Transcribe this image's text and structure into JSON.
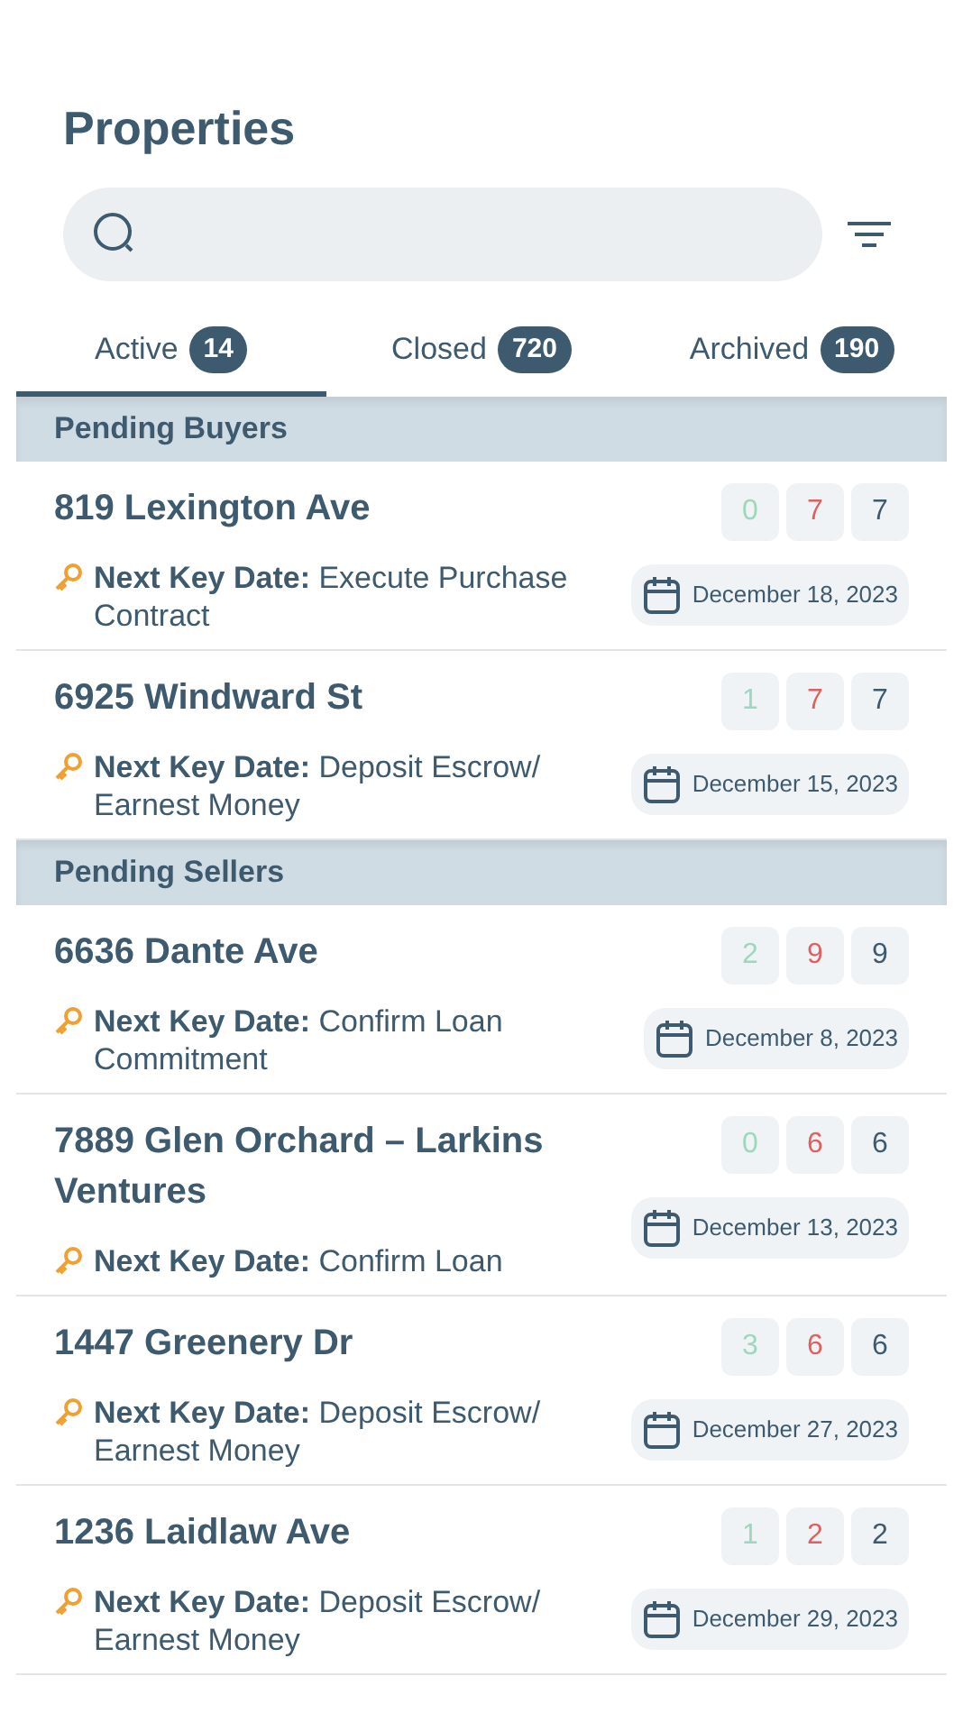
{
  "title": "Properties",
  "tabs": [
    {
      "label": "Active",
      "count": "14",
      "selected": true
    },
    {
      "label": "Closed",
      "count": "720",
      "selected": false
    },
    {
      "label": "Archived",
      "count": "190",
      "selected": false
    }
  ],
  "sections": [
    {
      "heading": "Pending Buyers",
      "items": [
        {
          "address": "819 Lexington Ave",
          "counts": {
            "done": "0",
            "overdue": "7",
            "total": "7"
          },
          "next_key": "**Next Key Date:** Execute Purchase Contract",
          "date": "December 18, 2023"
        },
        {
          "address": "6925 Windward St",
          "counts": {
            "done": "1",
            "overdue": "7",
            "total": "7"
          },
          "next_key": "**Next Key Date:** Deposit Escrow/ Earnest Money",
          "date": "December 15, 2023"
        }
      ]
    },
    {
      "heading": "Pending Sellers",
      "items": [
        {
          "address": "6636 Dante Ave",
          "counts": {
            "done": "2",
            "overdue": "9",
            "total": "9"
          },
          "next_key": "**Next Key Date:** Confirm Loan Commitment",
          "date": "December 8, 2023"
        },
        {
          "address": "7889 Glen Orchard – Larkins Ventures",
          "counts": {
            "done": "0",
            "overdue": "6",
            "total": "6"
          },
          "next_key": "**Next Key Date:** Confirm Loan",
          "date": "December 13, 2023"
        },
        {
          "address": "1447 Greenery Dr",
          "counts": {
            "done": "3",
            "overdue": "6",
            "total": "6"
          },
          "next_key": "**Next Key Date:** Deposit Escrow/ Earnest Money",
          "date": "December 27, 2023"
        },
        {
          "address": "1236 Laidlaw Ave",
          "counts": {
            "done": "1",
            "overdue": "2",
            "total": "2"
          },
          "next_key": "**Next Key Date:** Deposit Escrow/ Earnest Money",
          "date": "December 29, 2023"
        }
      ]
    }
  ]
}
